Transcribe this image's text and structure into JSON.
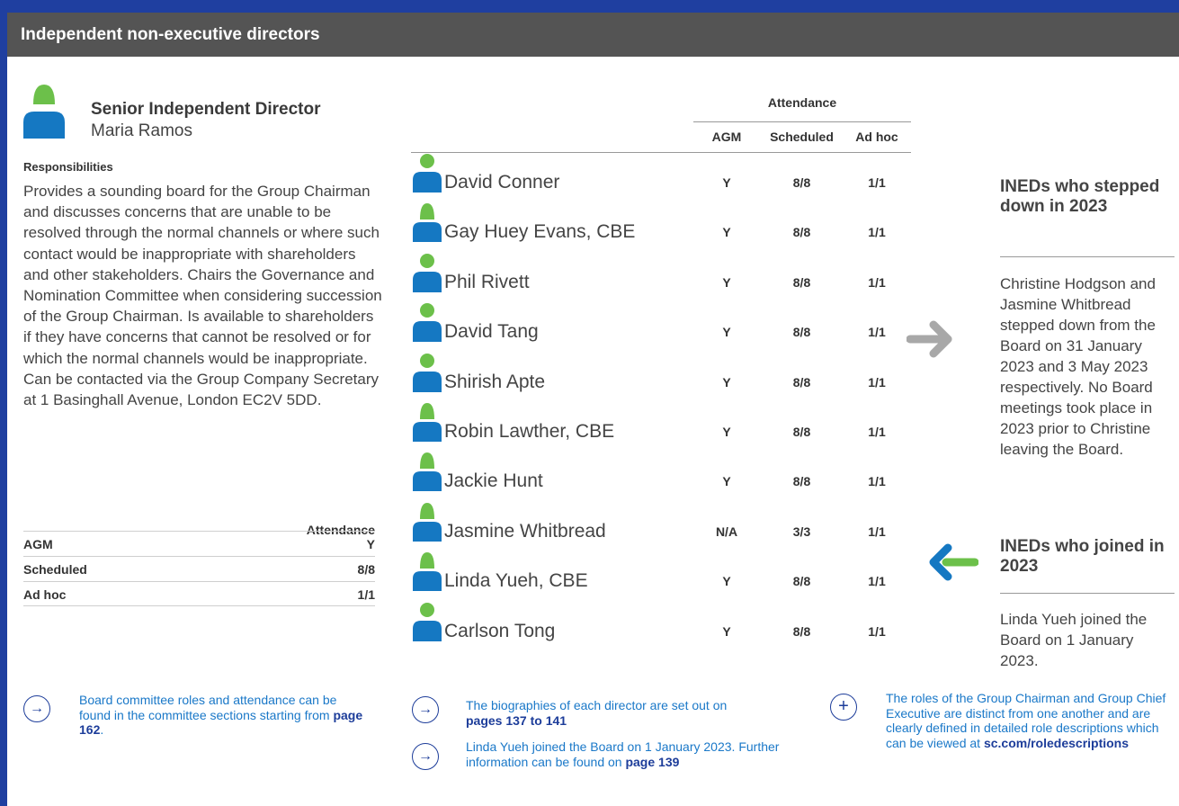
{
  "header": {
    "title": "Independent non-executive directors"
  },
  "senior": {
    "role": "Senior Independent Director",
    "name": "Maria Ramos",
    "resp_heading": "Responsibilities",
    "resp_text": "Provides a sounding board for the Group Chairman and discusses concerns that are unable to be resolved through the normal channels or where such contact would be inappropriate with shareholders and other stakeholders. Chairs the Governance and Nomination Committee when considering succession of the Group Chairman. Is available to shareholders if they have concerns that cannot be resolved or for which the normal channels would be inappropriate. Can be contacted via the Group Company Secretary at 1 Basinghall Avenue, London EC2V 5DD.",
    "attendance_heading": "Attendance",
    "attendance": [
      {
        "label": "AGM",
        "value": "Y"
      },
      {
        "label": "Scheduled",
        "value": "8/8"
      },
      {
        "label": "Ad hoc",
        "value": "1/1"
      }
    ]
  },
  "table": {
    "group_heading": "Attendance",
    "columns": [
      "AGM",
      "Scheduled",
      "Ad hoc"
    ],
    "rows": [
      {
        "name": "David Conner",
        "agm": "Y",
        "scheduled": "8/8",
        "adhoc": "1/1",
        "icon": "male-person-icon"
      },
      {
        "name": "Gay Huey Evans, CBE",
        "agm": "Y",
        "scheduled": "8/8",
        "adhoc": "1/1",
        "icon": "female-person-icon"
      },
      {
        "name": "Phil Rivett",
        "agm": "Y",
        "scheduled": "8/8",
        "adhoc": "1/1",
        "icon": "male-person-icon"
      },
      {
        "name": "David Tang",
        "agm": "Y",
        "scheduled": "8/8",
        "adhoc": "1/1",
        "icon": "male-person-icon"
      },
      {
        "name": "Shirish Apte",
        "agm": "Y",
        "scheduled": "8/8",
        "adhoc": "1/1",
        "icon": "male-person-icon"
      },
      {
        "name": "Robin Lawther, CBE",
        "agm": "Y",
        "scheduled": "8/8",
        "adhoc": "1/1",
        "icon": "female-person-icon"
      },
      {
        "name": "Jackie Hunt",
        "agm": "Y",
        "scheduled": "8/8",
        "adhoc": "1/1",
        "icon": "female-person-icon"
      },
      {
        "name": "Jasmine Whitbread",
        "agm": "N/A",
        "scheduled": "3/3",
        "adhoc": "1/1",
        "icon": "female-person-icon"
      },
      {
        "name": "Linda Yueh, CBE",
        "agm": "Y",
        "scheduled": "8/8",
        "adhoc": "1/1",
        "icon": "female-person-icon"
      },
      {
        "name": "Carlson Tong",
        "agm": "Y",
        "scheduled": "8/8",
        "adhoc": "1/1",
        "icon": "male-person-icon"
      }
    ]
  },
  "side": {
    "stepped_heading": "INEDs who stepped down in 2023",
    "stepped_text": "Christine Hodgson and Jasmine Whitbread stepped down from the Board on 31 January 2023 and 3 May 2023 respectively. No Board meetings took place in 2023 prior to Christine leaving the Board.",
    "joined_heading": "INEDs who joined in 2023",
    "joined_text": "Linda Yueh joined the Board on 1 January 2023."
  },
  "notes": {
    "n1_text": "Board committee roles and attendance can be found in the committee sections starting from ",
    "n1_link": "page 162",
    "n1_end": ".",
    "n2_text": "The biographies of each director are set out on ",
    "n2_link": "pages 137 to 141",
    "n3_text": "Linda Yueh joined the Board on 1 January 2023. Further information can be found on ",
    "n3_link": "page 139",
    "n4_text": "The roles of the Group Chairman and Group Chief Executive are distinct from one another and are clearly defined in detailed role descriptions which can be viewed at ",
    "n4_link": "sc.com/roledescriptions"
  },
  "colors": {
    "green": "#6cc04a",
    "blue": "#1578c2",
    "navy": "#1d3d9a",
    "grey_arrow": "#a8a8a8"
  }
}
